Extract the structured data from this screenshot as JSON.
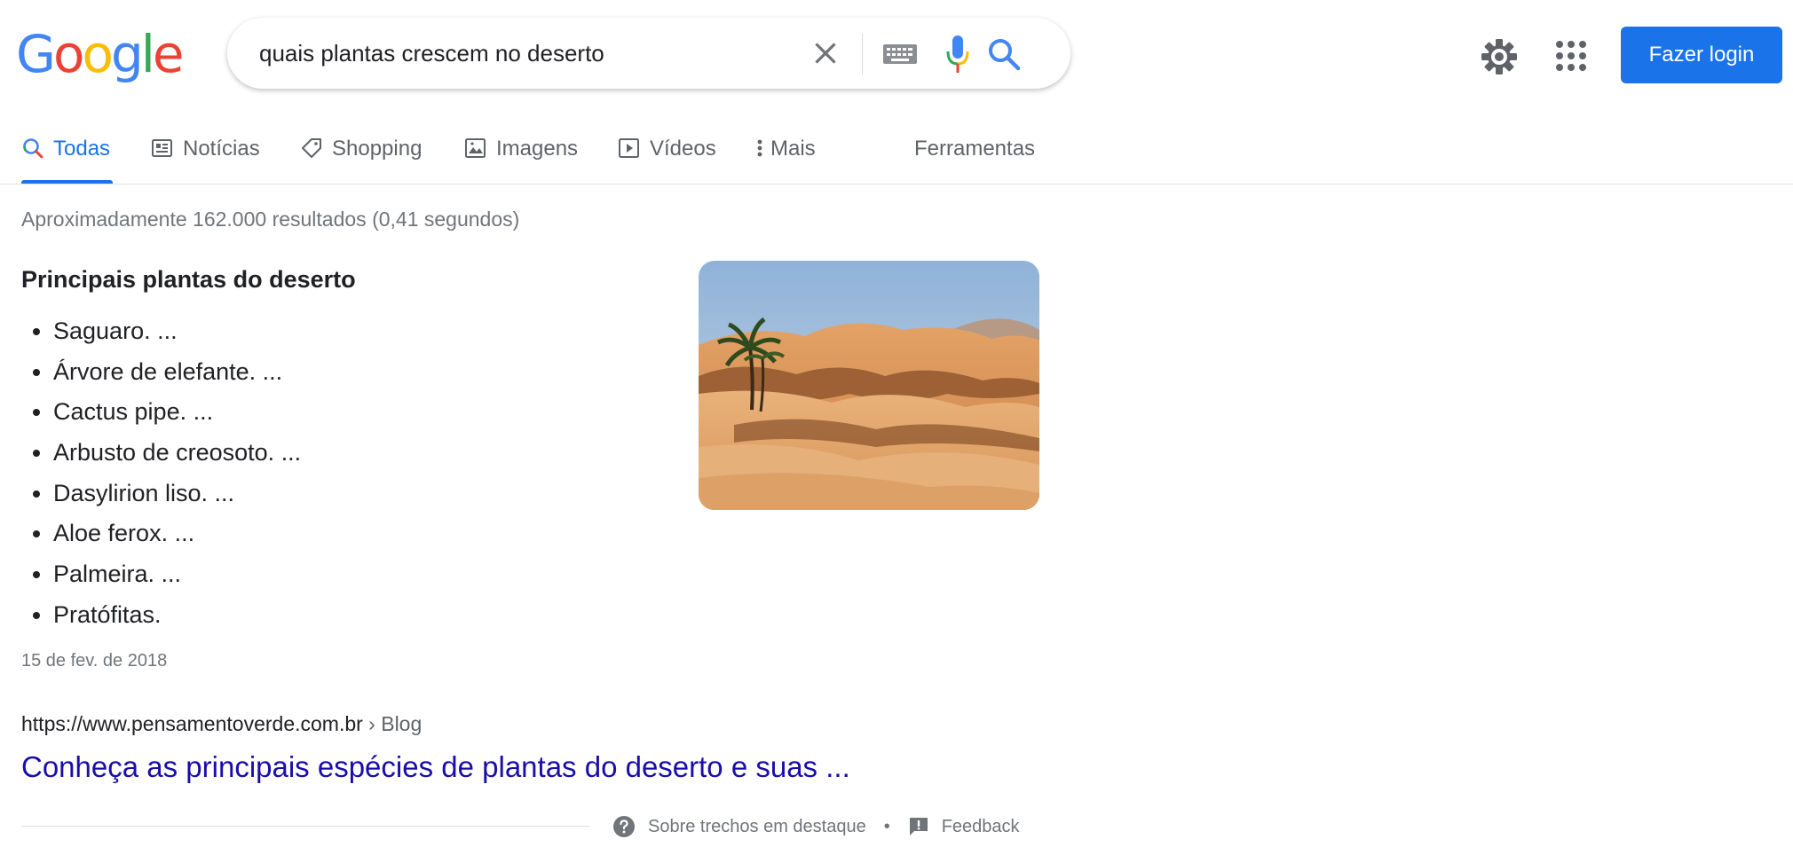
{
  "header": {
    "logo_letters": [
      "G",
      "o",
      "o",
      "g",
      "l",
      "e"
    ],
    "search_value": "quais plantas crescem no deserto",
    "login_label": "Fazer login"
  },
  "tabs": [
    {
      "label": "Todas",
      "icon": "search-icon",
      "active": true
    },
    {
      "label": "Notícias",
      "icon": "news-icon"
    },
    {
      "label": "Shopping",
      "icon": "tag-icon"
    },
    {
      "label": "Imagens",
      "icon": "image-icon"
    },
    {
      "label": "Vídeos",
      "icon": "play-icon"
    },
    {
      "label": "Mais",
      "icon": "more-vert-icon"
    },
    {
      "label": "Ferramentas"
    }
  ],
  "result_stats": "Aproximadamente 162.000 resultados (0,41 segundos)",
  "snippet": {
    "title": "Principais plantas do deserto",
    "items": [
      "Saguaro. ...",
      "Árvore de elefante. ...",
      "Cactus pipe. ...",
      "Arbusto de creosoto. ...",
      "Dasylirion liso. ...",
      "Aloe ferox. ...",
      "Palmeira. ...",
      "Pratófitas."
    ],
    "date": "15 de fev. de 2018",
    "image": "desert-dunes-palm-photo"
  },
  "result": {
    "url": "https://www.pensamentoverde.com.br",
    "breadcrumb": " › Blog",
    "title": "Conheça as principais espécies de plantas do deserto e suas ..."
  },
  "footer": {
    "about_label": "Sobre trechos em destaque",
    "separator": "•",
    "feedback_label": "Feedback"
  },
  "colors": {
    "google_blue": "#4285F4",
    "google_red": "#EA4335",
    "google_yellow": "#FBBC05",
    "google_green": "#34A853",
    "accent": "#1a73e8",
    "link": "#1a0dab"
  }
}
